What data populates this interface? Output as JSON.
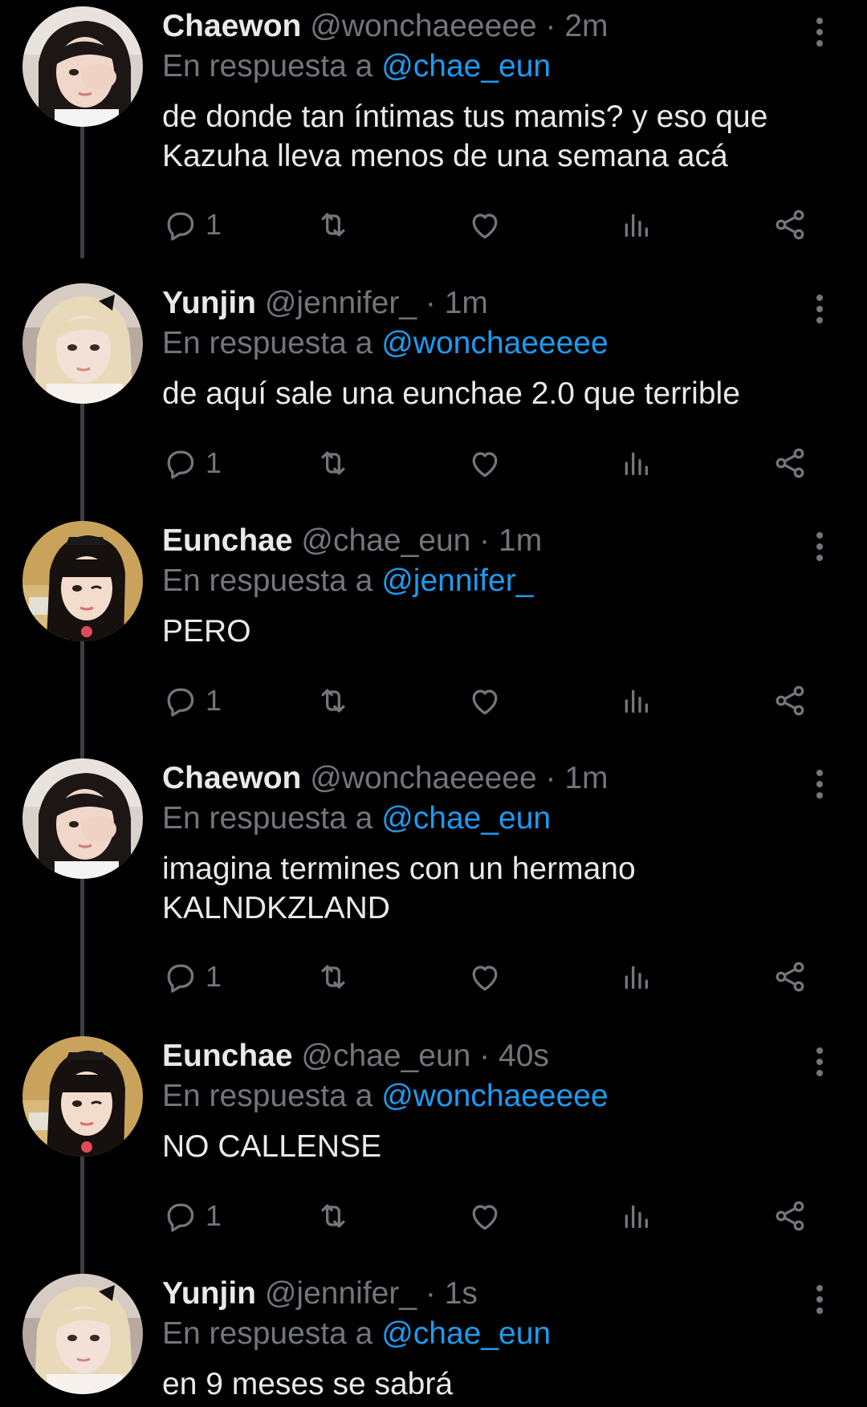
{
  "colors": {
    "background": "#000000",
    "primary_text": "#e7e9ea",
    "secondary_text": "#71767b",
    "mention": "#1d9bf0",
    "thread_line": "#3a3f44"
  },
  "reply_prefix": "En respuesta a",
  "tweets": [
    {
      "name": "Chaewon",
      "handle": "@wonchaeeeee",
      "separator": "·",
      "time": "2m",
      "reply_to": "@chae_eun",
      "text": "de donde tan íntimas tus mamis? y eso que Kazuha lleva menos de una semana acá",
      "reply_count": "1",
      "avatar_icon": "profile-photo-chaewon"
    },
    {
      "name": "Yunjin",
      "handle": "@jennifer_",
      "separator": "·",
      "time": "1m",
      "reply_to": "@wonchaeeeee",
      "text": "de aquí sale una eunchae 2.0 que terrible",
      "reply_count": "1",
      "avatar_icon": "profile-photo-yunjin"
    },
    {
      "name": "Eunchae",
      "handle": "@chae_eun",
      "separator": "·",
      "time": "1m",
      "reply_to": "@jennifer_",
      "text": "PERO",
      "reply_count": "1",
      "avatar_icon": "profile-photo-eunchae"
    },
    {
      "name": "Chaewon",
      "handle": "@wonchaeeeee",
      "separator": "·",
      "time": "1m",
      "reply_to": "@chae_eun",
      "text": "imagina termines con un hermano KALNDKZLAND",
      "reply_count": "1",
      "avatar_icon": "profile-photo-chaewon"
    },
    {
      "name": "Eunchae",
      "handle": "@chae_eun",
      "separator": "·",
      "time": "40s",
      "reply_to": "@wonchaeeeee",
      "text": "NO CALLENSE",
      "reply_count": "1",
      "avatar_icon": "profile-photo-eunchae"
    },
    {
      "name": "Yunjin",
      "handle": "@jennifer_",
      "separator": "·",
      "time": "1s",
      "reply_to": "@chae_eun",
      "text": "en 9 meses se sabrá",
      "reply_count": "",
      "avatar_icon": "profile-photo-yunjin"
    }
  ],
  "action_icons": [
    "reply-icon",
    "retweet-icon",
    "like-icon",
    "views-icon",
    "share-icon"
  ]
}
